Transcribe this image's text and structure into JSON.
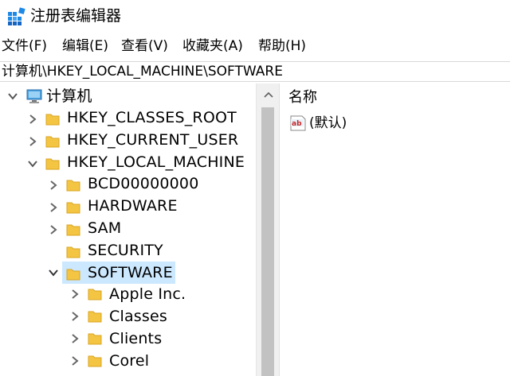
{
  "window": {
    "title": "注册表编辑器",
    "icon": "registry-editor-icon"
  },
  "menu": [
    {
      "label": "文件(F)"
    },
    {
      "label": "编辑(E)"
    },
    {
      "label": "查看(V)"
    },
    {
      "label": "收藏夹(A)"
    },
    {
      "label": "帮助(H)"
    }
  ],
  "address": {
    "path": "计算机\\HKEY_LOCAL_MACHINE\\SOFTWARE"
  },
  "tree": {
    "root": {
      "label": "计算机",
      "expanded": true,
      "icon": "computer-icon"
    },
    "hives": [
      {
        "label": "HKEY_CLASSES_ROOT",
        "expanded": false
      },
      {
        "label": "HKEY_CURRENT_USER",
        "expanded": false
      },
      {
        "label": "HKEY_LOCAL_MACHINE",
        "expanded": true
      }
    ],
    "hklm_children": [
      {
        "label": "BCD00000000",
        "expanded": false
      },
      {
        "label": "HARDWARE",
        "expanded": false
      },
      {
        "label": "SAM",
        "expanded": false
      },
      {
        "label": "SECURITY",
        "expanded": false
      },
      {
        "label": "SOFTWARE",
        "expanded": true,
        "selected": true
      }
    ],
    "software_children": [
      {
        "label": "Apple Inc."
      },
      {
        "label": "Classes"
      },
      {
        "label": "Clients"
      },
      {
        "label": "Corel"
      }
    ]
  },
  "values_pane": {
    "column_name": "名称",
    "rows": [
      {
        "name": "(默认)",
        "icon": "string-value-icon"
      }
    ]
  },
  "colors": {
    "folder": "#f4c542",
    "selection": "#cce8ff",
    "chevron": "#555555"
  }
}
